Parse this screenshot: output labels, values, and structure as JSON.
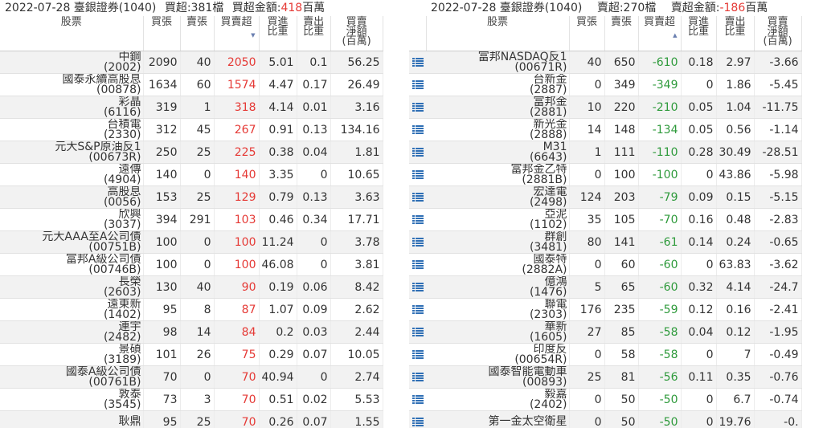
{
  "colors": {
    "buy": "#e53935",
    "sell": "#2e9a3b",
    "accent": "#2f6fb5"
  },
  "left": {
    "caption": {
      "date_broker": "2022-07-28 臺銀證券(1040)",
      "count": "買超:381檔",
      "amount_label": "買超金額:",
      "amount_value": "418",
      "amount_unit": "百萬"
    },
    "headers": [
      "股票",
      "買張",
      "賣張",
      "買賣超",
      "買進\n比重",
      "賣出\n比重",
      "買賣\n淨額\n(百萬)"
    ],
    "sort_icon": "sort-desc-icon",
    "rows": [
      {
        "name": "中鋼",
        "code": "(2002)",
        "buy": "2090",
        "sell": "40",
        "net": "2050",
        "buy_pct": "5.01",
        "sell_pct": "0.1",
        "amount": "56.25"
      },
      {
        "name": "國泰永續高股息",
        "code": "(00878)",
        "buy": "1634",
        "sell": "60",
        "net": "1574",
        "buy_pct": "4.47",
        "sell_pct": "0.17",
        "amount": "26.49"
      },
      {
        "name": "彩晶",
        "code": "(6116)",
        "buy": "319",
        "sell": "1",
        "net": "318",
        "buy_pct": "4.14",
        "sell_pct": "0.01",
        "amount": "3.16"
      },
      {
        "name": "台積電",
        "code": "(2330)",
        "buy": "312",
        "sell": "45",
        "net": "267",
        "buy_pct": "0.91",
        "sell_pct": "0.13",
        "amount": "134.16"
      },
      {
        "name": "元大S&P原油反1",
        "code": "(00673R)",
        "buy": "250",
        "sell": "25",
        "net": "225",
        "buy_pct": "0.38",
        "sell_pct": "0.04",
        "amount": "1.81"
      },
      {
        "name": "遠傳",
        "code": "(4904)",
        "buy": "140",
        "sell": "0",
        "net": "140",
        "buy_pct": "3.35",
        "sell_pct": "0",
        "amount": "10.65"
      },
      {
        "name": "高股息",
        "code": "(0056)",
        "buy": "153",
        "sell": "25",
        "net": "129",
        "buy_pct": "0.79",
        "sell_pct": "0.13",
        "amount": "3.63"
      },
      {
        "name": "欣興",
        "code": "(3037)",
        "buy": "394",
        "sell": "291",
        "net": "103",
        "buy_pct": "0.46",
        "sell_pct": "0.34",
        "amount": "17.71"
      },
      {
        "name": "元大AAA至A公司債",
        "code": "(00751B)",
        "buy": "100",
        "sell": "0",
        "net": "100",
        "buy_pct": "11.24",
        "sell_pct": "0",
        "amount": "3.78"
      },
      {
        "name": "富邦A級公司債",
        "code": "(00746B)",
        "buy": "100",
        "sell": "0",
        "net": "100",
        "buy_pct": "46.08",
        "sell_pct": "0",
        "amount": "3.81"
      },
      {
        "name": "長榮",
        "code": "(2603)",
        "buy": "130",
        "sell": "40",
        "net": "90",
        "buy_pct": "0.19",
        "sell_pct": "0.06",
        "amount": "8.42"
      },
      {
        "name": "遠東新",
        "code": "(1402)",
        "buy": "95",
        "sell": "8",
        "net": "87",
        "buy_pct": "1.07",
        "sell_pct": "0.09",
        "amount": "2.62"
      },
      {
        "name": "連宇",
        "code": "(2482)",
        "buy": "98",
        "sell": "14",
        "net": "84",
        "buy_pct": "0.2",
        "sell_pct": "0.03",
        "amount": "2.44"
      },
      {
        "name": "景碩",
        "code": "(3189)",
        "buy": "101",
        "sell": "26",
        "net": "75",
        "buy_pct": "0.29",
        "sell_pct": "0.07",
        "amount": "10.05"
      },
      {
        "name": "國泰A級公司債",
        "code": "(00761B)",
        "buy": "70",
        "sell": "0",
        "net": "70",
        "buy_pct": "40.94",
        "sell_pct": "0",
        "amount": "2.74"
      },
      {
        "name": "敦泰",
        "code": "(3545)",
        "buy": "73",
        "sell": "3",
        "net": "70",
        "buy_pct": "0.51",
        "sell_pct": "0.02",
        "amount": "5.53"
      },
      {
        "name": "耿鼎",
        "code": "",
        "buy": "95",
        "sell": "25",
        "net": "70",
        "buy_pct": "0.26",
        "sell_pct": "0.07",
        "amount": "1.55"
      }
    ]
  },
  "right": {
    "caption": {
      "date_broker": "2022-07-28 臺銀證券(1040)",
      "count": "賣超:270檔",
      "amount_label": "賣超金額:",
      "amount_value": "-186",
      "amount_unit": "百萬"
    },
    "headers": [
      "股票",
      "買張",
      "賣張",
      "買賣超",
      "買進\n比重",
      "賣出\n比重",
      "買賣\n淨額\n(百萬)"
    ],
    "sort_icon": "sort-asc-icon",
    "row_icon": "list-icon",
    "rows": [
      {
        "name": "富邦NASDAQ反1",
        "code": "(00671R)",
        "buy": "40",
        "sell": "650",
        "net": "-610",
        "buy_pct": "0.18",
        "sell_pct": "2.97",
        "amount": "-3.66"
      },
      {
        "name": "台新金",
        "code": "(2887)",
        "buy": "0",
        "sell": "349",
        "net": "-349",
        "buy_pct": "0",
        "sell_pct": "1.86",
        "amount": "-5.45"
      },
      {
        "name": "富邦金",
        "code": "(2881)",
        "buy": "10",
        "sell": "220",
        "net": "-210",
        "buy_pct": "0.05",
        "sell_pct": "1.04",
        "amount": "-11.75"
      },
      {
        "name": "新光金",
        "code": "(2888)",
        "buy": "14",
        "sell": "148",
        "net": "-134",
        "buy_pct": "0.05",
        "sell_pct": "0.56",
        "amount": "-1.14"
      },
      {
        "name": "M31",
        "code": "(6643)",
        "buy": "1",
        "sell": "111",
        "net": "-110",
        "buy_pct": "0.28",
        "sell_pct": "30.49",
        "amount": "-28.51"
      },
      {
        "name": "富邦金乙特",
        "code": "(2881B)",
        "buy": "0",
        "sell": "100",
        "net": "-100",
        "buy_pct": "0",
        "sell_pct": "43.86",
        "amount": "-5.98"
      },
      {
        "name": "宏達電",
        "code": "(2498)",
        "buy": "124",
        "sell": "203",
        "net": "-79",
        "buy_pct": "0.09",
        "sell_pct": "0.15",
        "amount": "-5.15"
      },
      {
        "name": "亞泥",
        "code": "(1102)",
        "buy": "35",
        "sell": "105",
        "net": "-70",
        "buy_pct": "0.16",
        "sell_pct": "0.48",
        "amount": "-2.83"
      },
      {
        "name": "群創",
        "code": "(3481)",
        "buy": "80",
        "sell": "141",
        "net": "-61",
        "buy_pct": "0.14",
        "sell_pct": "0.24",
        "amount": "-0.65"
      },
      {
        "name": "國泰特",
        "code": "(2882A)",
        "buy": "0",
        "sell": "60",
        "net": "-60",
        "buy_pct": "0",
        "sell_pct": "63.83",
        "amount": "-3.62"
      },
      {
        "name": "億鴻",
        "code": "(1476)",
        "buy": "5",
        "sell": "65",
        "net": "-60",
        "buy_pct": "0.32",
        "sell_pct": "4.14",
        "amount": "-24.7"
      },
      {
        "name": "聯電",
        "code": "(2303)",
        "buy": "176",
        "sell": "235",
        "net": "-59",
        "buy_pct": "0.12",
        "sell_pct": "0.16",
        "amount": "-2.41"
      },
      {
        "name": "華新",
        "code": "(1605)",
        "buy": "27",
        "sell": "85",
        "net": "-58",
        "buy_pct": "0.04",
        "sell_pct": "0.12",
        "amount": "-1.95"
      },
      {
        "name": "印度反",
        "code": "(00654R)",
        "buy": "0",
        "sell": "58",
        "net": "-58",
        "buy_pct": "0",
        "sell_pct": "7",
        "amount": "-0.49"
      },
      {
        "name": "國泰智能電動車",
        "code": "(00893)",
        "buy": "25",
        "sell": "81",
        "net": "-56",
        "buy_pct": "0.11",
        "sell_pct": "0.35",
        "amount": "-0.76"
      },
      {
        "name": "毅嘉",
        "code": "(2402)",
        "buy": "0",
        "sell": "50",
        "net": "-50",
        "buy_pct": "0",
        "sell_pct": "6.7",
        "amount": "-0.74"
      },
      {
        "name": "第一金太空衛星",
        "code": "",
        "buy": "0",
        "sell": "50",
        "net": "-50",
        "buy_pct": "0",
        "sell_pct": "19.76",
        "amount": "-0."
      }
    ]
  }
}
